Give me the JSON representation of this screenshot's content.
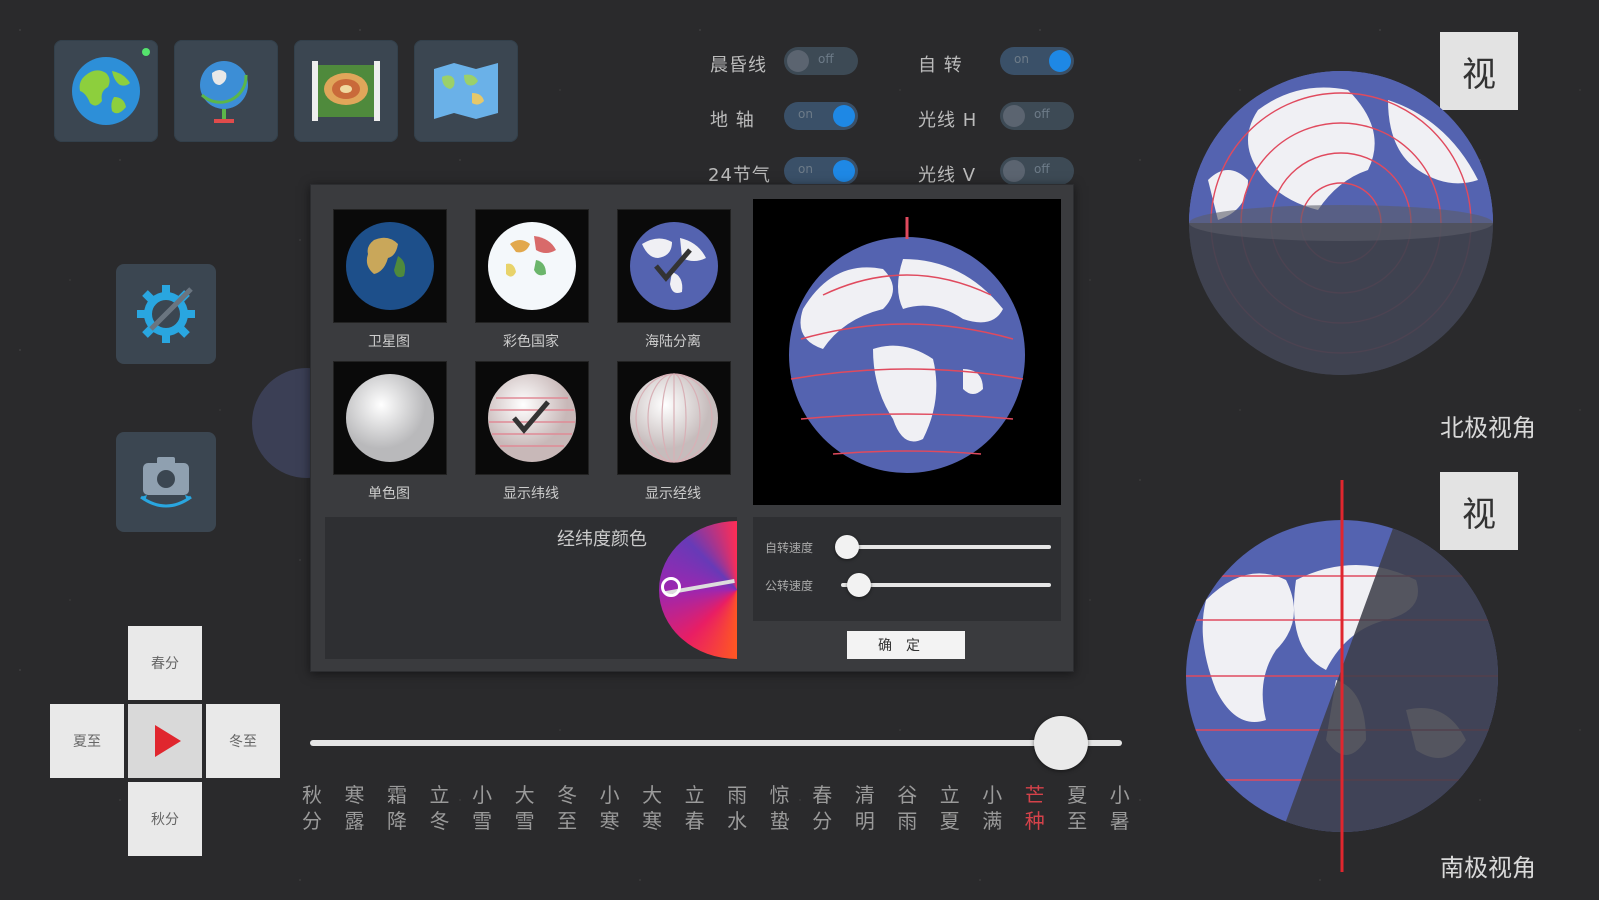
{
  "map_modes": [
    {
      "name": "earth-globe",
      "active": true
    },
    {
      "name": "globe-stand"
    },
    {
      "name": "terrain-map"
    },
    {
      "name": "world-map"
    }
  ],
  "toggles": {
    "morning_line": {
      "label": "晨昏线",
      "state": "off"
    },
    "rotation": {
      "label": "自  转",
      "state": "on"
    },
    "axis": {
      "label": "地  轴",
      "state": "on"
    },
    "light_h": {
      "label": "光线 H",
      "state": "off"
    },
    "solar_terms": {
      "label": "24节气",
      "state": "on"
    },
    "light_v": {
      "label": "光线 V",
      "state": "off"
    }
  },
  "panel": {
    "thumbnails": [
      {
        "label": "卫星图"
      },
      {
        "label": "彩色国家"
      },
      {
        "label": "海陆分离",
        "checked": true
      },
      {
        "label": "单色图"
      },
      {
        "label": "显示纬线",
        "checked": true
      },
      {
        "label": "显示经线"
      }
    ],
    "color_label": "经纬度颜色",
    "sliders": [
      {
        "label": "自转速度",
        "value": 0.0
      },
      {
        "label": "公转速度",
        "value": 0.06
      }
    ],
    "ok_label": "确定"
  },
  "seasons": {
    "spring": "春分",
    "summer": "夏至",
    "winter": "冬至",
    "autumn": "秋分"
  },
  "timeline": {
    "position": 0.92,
    "terms": [
      "秋分",
      "寒露",
      "霜降",
      "立冬",
      "小雪",
      "大雪",
      "冬至",
      "小寒",
      "大寒",
      "立春",
      "雨水",
      "惊蛰",
      "春分",
      "清明",
      "谷雨",
      "立夏",
      "小满",
      "芒种",
      "夏至",
      "小暑"
    ],
    "active_index": 17
  },
  "views": {
    "button_label": "视",
    "north_label": "北极视角",
    "south_label": "南极视角"
  },
  "colors": {
    "ocean": "#5463b0",
    "land": "#f0f0f4",
    "latline": "#e04a5e",
    "accent": "#1e88e5"
  }
}
